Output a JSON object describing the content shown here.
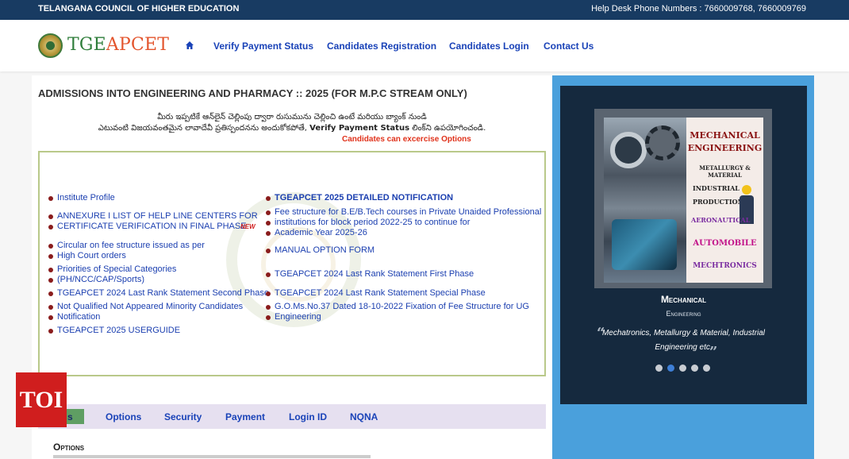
{
  "topbar": {
    "org": "TELANGANA COUNCIL OF HIGHER EDUCATION",
    "helpdesk": "Help Desk Phone Numbers : 7660009768, 7660009769"
  },
  "brand": {
    "part1": "TGE",
    "part2": "APCET"
  },
  "nav": {
    "home_icon": "home-icon",
    "items": [
      "Verify Payment Status",
      "Candidates Registration",
      "Candidates Login",
      "Contact Us"
    ]
  },
  "main": {
    "title": "ADMISSIONS INTO ENGINEERING AND PHARMACY :: 2025  (FOR M.P.C STREAM ONLY)",
    "telugu_line1": "మీరు ఇప్పటికే ఆన్‌లైన్ చెల్లింపు ద్వారా రుసుమును చెల్లించి ఉంటే మరియు బ్యాంక్ నుండి",
    "telugu_line2_pre": "ఎటువంటి విజయవంతమైన లావాదేవీ ప్రతిస్పందనను అందుకోకపోతే, ",
    "telugu_line2_bold": "Verify Payment Status",
    "telugu_line2_post": " లింక్‌ని ఉపయోగించండి.",
    "notice": "Candidates can excercise Options"
  },
  "links_left": [
    "Institute Profile",
    "ANNEXURE I LIST OF HELP LINE CENTERS FOR",
    "CERTIFICATE VERIFICATION IN FINAL PHASE",
    "Circular on fee structure issued as per",
    "High Court orders",
    "Priorities of Special Categories",
    "(PH/NCC/CAP/Sports)",
    "TGEAPCET 2024 Last Rank Statement Second Phase",
    "Not Qualified Not Appeared Minority Candidates",
    "Notification",
    "TGEAPCET 2025 USERGUIDE"
  ],
  "new_badge": "NEW",
  "links_right": [
    "TGEAPCET 2025 DETAILED NOTIFICATION",
    "Fee structure for B.E/B.Tech courses in Private Unaided Professional",
    "institutions for block period 2022-25 to continue for",
    "Academic Year 2025-26",
    "MANUAL OPTION FORM",
    "TGEAPCET 2024 Last Rank Statement First Phase",
    "TGEAPCET 2024 Last Rank Statement Special Phase",
    "G.O.Ms.No.37 Dated 18-10-2022 Fixation of Fee Structure for UG",
    "Engineering"
  ],
  "tabs": {
    "active_partial": "s",
    "items": [
      "Options",
      "Security",
      "Payment",
      "Login ID",
      "NQNA"
    ]
  },
  "options_heading": "Options",
  "toi_logo": "TOI",
  "carousel": {
    "poster_lines": [
      "MECHANICAL",
      "ENGINEERING",
      "METALLURGY & MATERIAL",
      "INDUSTRIAL",
      "PRODUCTION",
      "AERONAUTICAL",
      "AUTOMOBILE",
      "MECHTRONICS"
    ],
    "caption_title": "Mechanical",
    "caption_sub": "Engineering",
    "desc_line1": "Mechatronics, Metallurgy & Material, Industrial",
    "desc_line2": "Engineering etc.",
    "open_quote": "“",
    "close_quote": "”",
    "slide_count": 5,
    "active_slide": 2
  }
}
